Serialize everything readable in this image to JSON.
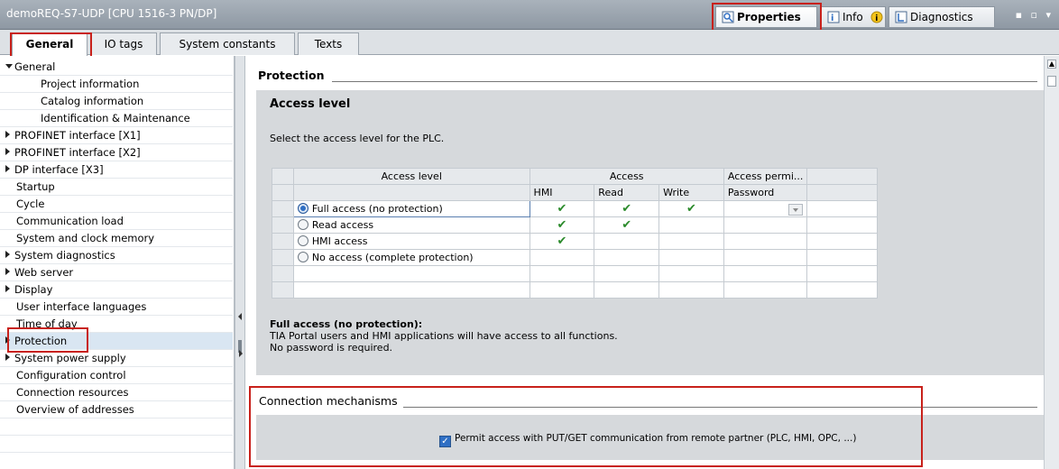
{
  "window": {
    "title": "demoREQ-S7-UDP [CPU 1516-3 PN/DP]",
    "side_tabs": [
      "Properties",
      "Info",
      "Diagnostics"
    ]
  },
  "tabs": [
    "General",
    "IO tags",
    "System constants",
    "Texts"
  ],
  "nav": {
    "items": [
      {
        "label": "General",
        "level": 0,
        "expander": "expanded"
      },
      {
        "label": "Project information",
        "level": 2
      },
      {
        "label": "Catalog information",
        "level": 2
      },
      {
        "label": "Identification & Maintenance",
        "level": 2
      },
      {
        "label": "PROFINET interface [X1]",
        "level": 0,
        "expander": "collapsed"
      },
      {
        "label": "PROFINET interface [X2]",
        "level": 0,
        "expander": "collapsed"
      },
      {
        "label": "DP interface [X3]",
        "level": 0,
        "expander": "collapsed"
      },
      {
        "label": "Startup",
        "level": 1
      },
      {
        "label": "Cycle",
        "level": 1
      },
      {
        "label": "Communication load",
        "level": 1
      },
      {
        "label": "System and clock memory",
        "level": 1
      },
      {
        "label": "System diagnostics",
        "level": 0,
        "expander": "collapsed"
      },
      {
        "label": "Web server",
        "level": 0,
        "expander": "collapsed"
      },
      {
        "label": "Display",
        "level": 0,
        "expander": "collapsed"
      },
      {
        "label": "User interface languages",
        "level": 1
      },
      {
        "label": "Time of day",
        "level": 1
      },
      {
        "label": "Protection",
        "level": 0,
        "expander": "collapsed",
        "selected": true
      },
      {
        "label": "System power supply",
        "level": 0,
        "expander": "collapsed"
      },
      {
        "label": "Configuration control",
        "level": 1
      },
      {
        "label": "Connection resources",
        "level": 1
      },
      {
        "label": "Overview of addresses",
        "level": 1
      }
    ]
  },
  "protection": {
    "heading": "Protection",
    "access_level": {
      "title": "Access level",
      "instruction": "Select the access level for the PLC.",
      "table": {
        "headers": {
          "access_level": "Access level",
          "access": "Access",
          "access_perm": "Access permi...",
          "hmi": "HMI",
          "read": "Read",
          "write": "Write",
          "password": "Password"
        },
        "rows": [
          {
            "label": "Full access (no protection)",
            "selected": true,
            "hmi": "✔",
            "read": "✔",
            "write": "✔"
          },
          {
            "label": "Read access",
            "selected": false,
            "hmi": "✔",
            "read": "✔",
            "write": ""
          },
          {
            "label": "HMI access",
            "selected": false,
            "hmi": "✔",
            "read": "",
            "write": ""
          },
          {
            "label": "No access (complete protection)",
            "selected": false,
            "hmi": "",
            "read": "",
            "write": ""
          }
        ]
      },
      "description": {
        "title": "Full access (no protection):",
        "line1": "TIA Portal users and HMI applications will have access to all functions.",
        "line2": "No password is required."
      }
    },
    "connection_mechanisms": {
      "heading": "Connection mechanisms",
      "checkbox_label": "Permit access with PUT/GET communication from remote partner (PLC, HMI, OPC, ...)",
      "checked": true
    }
  },
  "colors": {
    "highlight_box": "#c8211b",
    "check_green": "#2a8a2a",
    "title_bar": "#9aa3ad"
  }
}
